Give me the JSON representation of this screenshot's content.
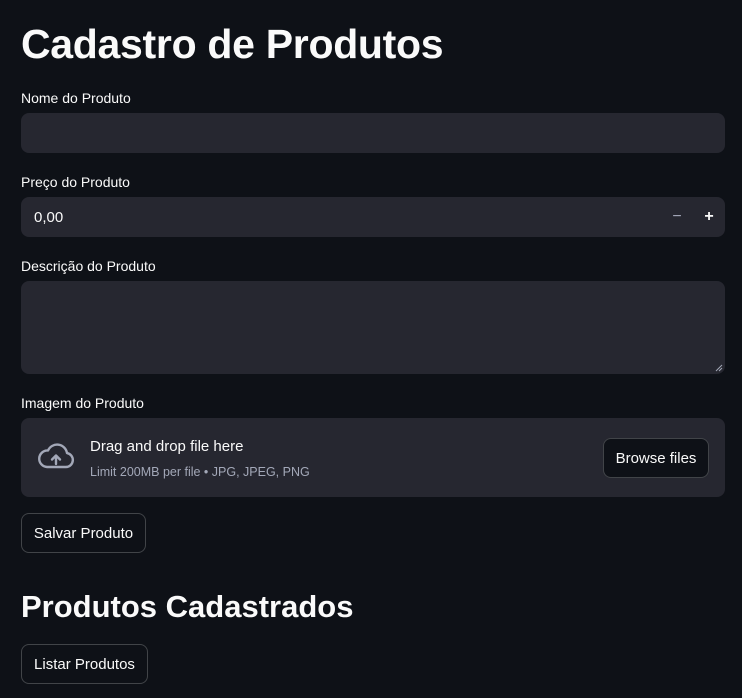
{
  "page": {
    "title": "Cadastro de Produtos",
    "section_title": "Produtos Cadastrados"
  },
  "form": {
    "name": {
      "label": "Nome do Produto",
      "value": "",
      "placeholder": ""
    },
    "price": {
      "label": "Preço do Produto",
      "value": "0,00",
      "decrement_label": "−",
      "increment_label": "+"
    },
    "description": {
      "label": "Descrição do Produto",
      "value": ""
    },
    "image": {
      "label": "Imagem do Produto",
      "drop_text": "Drag and drop file here",
      "limit_text": "Limit 200MB per file • JPG, JPEG, PNG",
      "browse_label": "Browse files",
      "icon": "cloud-upload-icon"
    },
    "save_label": "Salvar Produto"
  },
  "list": {
    "button_label": "Listar Produtos"
  },
  "colors": {
    "background": "#0e1117",
    "input_background": "#262730",
    "text": "#fafafa",
    "muted_text": "#a3a8b8"
  }
}
